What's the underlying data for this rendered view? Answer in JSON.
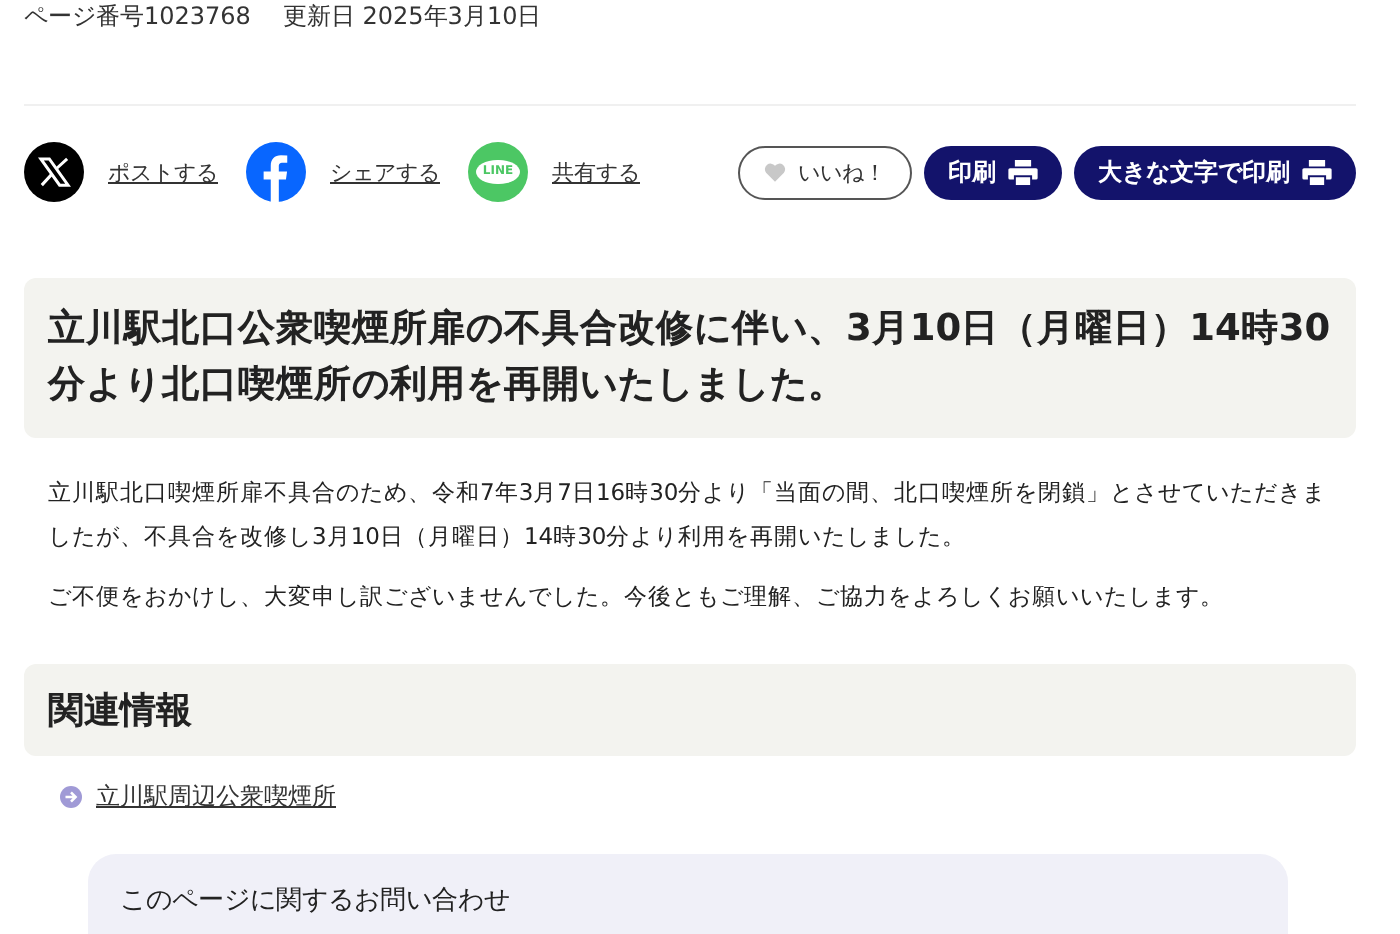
{
  "meta": {
    "page_number": "ページ番号1023768",
    "updated": "更新日 2025年3月10日"
  },
  "share": [
    {
      "kind": "x",
      "label": "ポストする"
    },
    {
      "kind": "facebook",
      "label": "シェアする"
    },
    {
      "kind": "line",
      "label": "共有する",
      "icon_text": "LINE"
    }
  ],
  "like_button": {
    "label": "いいね！"
  },
  "print_buttons": [
    {
      "label": "印刷"
    },
    {
      "label": "大きな文字で印刷"
    }
  ],
  "title": "立川駅北口公衆喫煙所扉の不具合改修に伴い、3月10日（月曜日）14時30分より北口喫煙所の利用を再開いたしました。",
  "paragraphs": [
    "立川駅北口喫煙所扉不具合のため、令和7年3月7日16時30分より「当面の間、北口喫煙所を閉鎖」とさせていただきましたが、不具合を改修し3月10日（月曜日）14時30分より利用を再開いたしました。",
    "ご不便をおかけし、大変申し訳ございませんでした。今後ともご理解、ご協力をよろしくお願いいたします。"
  ],
  "related": {
    "heading": "関連情報",
    "links": [
      "立川駅周辺公衆喫煙所"
    ]
  },
  "contact": {
    "heading": "このページに関するお問い合わせ"
  }
}
